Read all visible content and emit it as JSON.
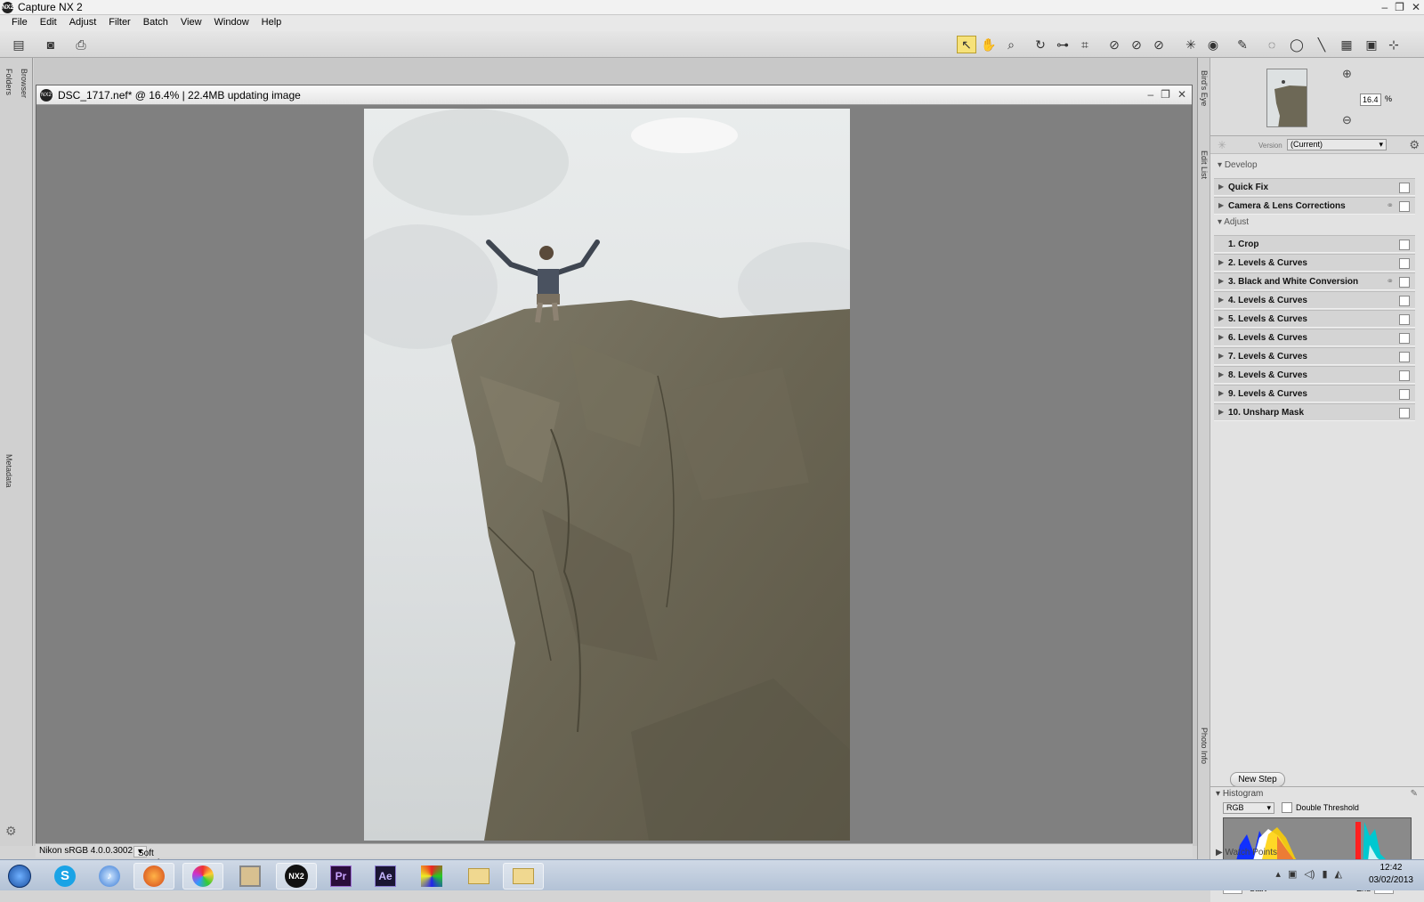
{
  "app": {
    "title": "Capture NX 2",
    "icon": "NX2"
  },
  "menu": [
    "File",
    "Edit",
    "Adjust",
    "Filter",
    "Batch",
    "View",
    "Window",
    "Help"
  ],
  "side_tabs": {
    "browser": "Browser",
    "folders": "Folders",
    "metadata": "Metadata",
    "birds_eye": "Bird's Eye",
    "edit_list": "Edit List",
    "photo_info": "Photo Info"
  },
  "document": {
    "title": "DSC_1717.nef* @ 16.4% | 22.4MB updating image"
  },
  "statusbar": {
    "profile": "Nikon sRGB 4.0.0.3002",
    "soft_proof": "Soft Proof Off"
  },
  "birds_eye": {
    "zoom_value": "16.4",
    "zoom_unit": "%"
  },
  "version": {
    "label": "Version",
    "value": "(Current)"
  },
  "edit_list": {
    "develop_label": "Develop",
    "adjust_label": "Adjust",
    "develop_steps": [
      {
        "label": "Quick Fix"
      },
      {
        "label": "Camera & Lens Corrections"
      }
    ],
    "adjust_steps": [
      {
        "label": "1. Crop"
      },
      {
        "label": "2. Levels & Curves"
      },
      {
        "label": "3. Black and White Conversion"
      },
      {
        "label": "4. Levels & Curves"
      },
      {
        "label": "5. Levels & Curves"
      },
      {
        "label": "6. Levels & Curves"
      },
      {
        "label": "7. Levels & Curves"
      },
      {
        "label": "8. Levels & Curves"
      },
      {
        "label": "9. Levels & Curves"
      },
      {
        "label": "10. Unsharp Mask"
      }
    ],
    "new_step": "New Step"
  },
  "histogram": {
    "title": "Histogram",
    "channel": "RGB",
    "double_threshold": "Double Threshold",
    "start_value": "-",
    "start_label": "Start",
    "end_label": "End",
    "end_value": "-"
  },
  "watch_points": "Watch Points",
  "taskbar": {
    "time": "12:42",
    "date": "03/02/2013"
  },
  "colors": {
    "active_tool": "#f6e27a",
    "canvas_bg": "#808080",
    "taskbar": "#c3cfdf"
  }
}
